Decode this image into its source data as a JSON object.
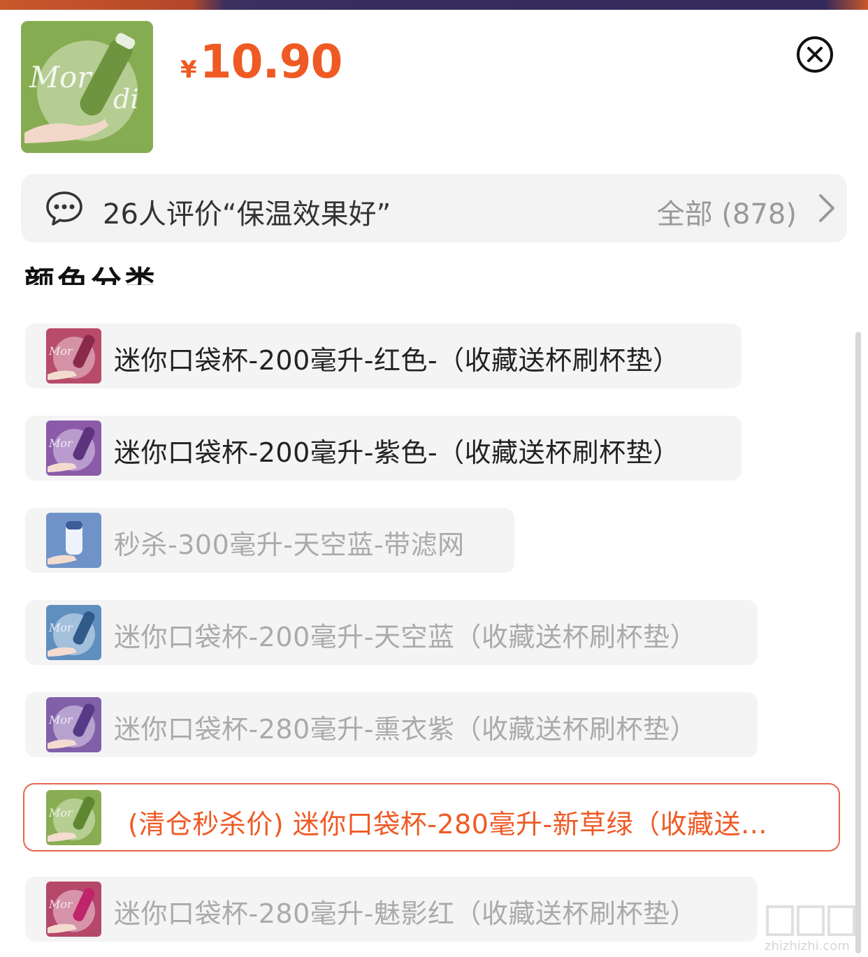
{
  "product": {
    "currency_symbol": "¥",
    "price": "10.90",
    "thumb_color": "#8bb055"
  },
  "review_bar": {
    "text": "26人评价“保温效果好”",
    "all_label": "全部 (878)"
  },
  "section": {
    "title": "颜色分类"
  },
  "options": [
    {
      "label": "迷你口袋杯-200毫升-红色-（收藏送杯刷杯垫）",
      "state": "enabled",
      "color": "#b84a6a"
    },
    {
      "label": "迷你口袋杯-200毫升-紫色-（收藏送杯刷杯垫）",
      "state": "enabled",
      "color": "#8b5aa8"
    },
    {
      "label": "秒杀-300毫升-天空蓝-带滤网",
      "state": "disabled",
      "color": "#6f93c8"
    },
    {
      "label": "迷你口袋杯-200毫升-天空蓝（收藏送杯刷杯垫）",
      "state": "disabled",
      "color": "#5f8fbf"
    },
    {
      "label": "迷你口袋杯-280毫升-熏衣紫（收藏送杯刷杯垫）",
      "state": "disabled",
      "color": "#8060a8"
    },
    {
      "label": "(清仓秒杀价) 迷你口袋杯-280毫升-新草绿（收藏送...",
      "state": "selected",
      "color": "#88ad52"
    },
    {
      "label": "迷你口袋杯-280毫升-魅影红（收藏送杯刷杯垫）",
      "state": "disabled",
      "color": "#b5486a"
    }
  ],
  "colors": {
    "accent": "#ef5a24",
    "selected_border": "#e8654a",
    "disabled_text": "#aaaaaa"
  },
  "watermark": {
    "text": "zhizhizhi.com"
  }
}
